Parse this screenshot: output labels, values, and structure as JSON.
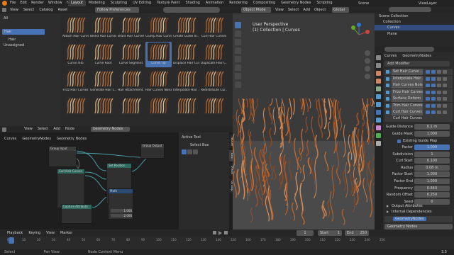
{
  "topbar": {
    "menus": [
      "File",
      "Edit",
      "Render",
      "Window",
      "Help"
    ],
    "workspaces": [
      "Layout",
      "Modeling",
      "Sculpting",
      "UV Editing",
      "Texture Paint",
      "Shading",
      "Animation",
      "Rendering",
      "Compositing",
      "Geometry Nodes",
      "Scripting"
    ],
    "active_workspace": "Layout",
    "scene": "Scene",
    "view_layer": "ViewLayer"
  },
  "asset_browser": {
    "header_menus": [
      "View",
      "Select",
      "Catalog",
      "Asset"
    ],
    "library": "Follow Preferences",
    "catalogs": [
      "All",
      "Hair",
      "Unassigned"
    ],
    "assets": [
      "Attach Hair Curve...",
      "Blend Hair Curves",
      "Braid Hair Curves",
      "Clump Hair Curves",
      "Create Guide In...",
      "Curl Hair Curves",
      "Curve Info",
      "Curve Root",
      "Curve Segment",
      "Curve Tip",
      "Displace Hair Cur...",
      "Duplicate Hair C...",
      "Frizz Hair Curves",
      "Generate Hair C...",
      "Hair Attachment...",
      "Hair Curves Noise",
      "Interpolate Hair ...",
      "Redistribute Cur...",
      "",
      "",
      "",
      "",
      "",
      ""
    ],
    "selected_asset": "Curve Tip"
  },
  "node_editor": {
    "menus": [
      "View",
      "Select",
      "Add",
      "Node"
    ],
    "node_tree": "Geometry Nodes",
    "breadcrumb": [
      "Curves",
      "GeometryNodes",
      "Geometry Nodes"
    ],
    "side_tabs": [
      "Node",
      "Tool",
      "View",
      "Group"
    ],
    "active_tool_title": "Active Tool",
    "active_tool_name": "Select Box",
    "nodes": {
      "group_input": "Group Input",
      "curl": "Curl Hair Curves",
      "group_output": "Group Output",
      "set_position": "Set Position",
      "capture": "Capture Attribute",
      "math": "Math",
      "value_a": "1.000",
      "value_b": "2.000"
    }
  },
  "viewport": {
    "mode": "Object Mode",
    "menus": [
      "View",
      "Select",
      "Add",
      "Object"
    ],
    "orientation": "Global",
    "perspective": "User Perspective",
    "collection": "(1) Collection | Curves"
  },
  "timeline": {
    "menus": [
      "Playback",
      "Keying",
      "View",
      "Marker"
    ],
    "current_frame": "1",
    "start_label": "Start",
    "start": "1",
    "end_label": "End",
    "end": "250",
    "ticks": [
      "0",
      "10",
      "20",
      "30",
      "40",
      "50",
      "60",
      "70",
      "80",
      "90",
      "100",
      "110",
      "120",
      "130",
      "140",
      "150",
      "160",
      "170",
      "180",
      "190",
      "200",
      "210",
      "220",
      "230",
      "240",
      "250"
    ]
  },
  "statusbar": {
    "items": [
      "Select",
      "Pan View",
      "Node Context Menu"
    ],
    "version": "3.5"
  },
  "outliner": {
    "items": [
      "Scene Collection",
      "Collection",
      "Curves",
      "Plane"
    ]
  },
  "properties": {
    "breadcrumb": [
      "Curves",
      "GeometryNodes"
    ],
    "add_modifier": "Add Modifier",
    "modifier_stack": [
      "Set Hair Curve ...",
      "Interpolate Hair...",
      "Hair Curves Noise",
      "Frizz Hair Curves",
      "Surface Deform",
      "Trim Hair Curves",
      "Curl Hair Curves"
    ],
    "curl_panel": {
      "title": "Curl Hair Curves",
      "fields": [
        {
          "label": "Guide Distance",
          "value": "0.1 m"
        },
        {
          "label": "Guide Mask",
          "value": "1.000"
        }
      ],
      "checkbox_label": "Existing Guide Map",
      "params": [
        {
          "label": "Factor",
          "value": "1.000",
          "accent": true
        },
        {
          "label": "Subdivision",
          "value": "1"
        },
        {
          "label": "Curl Start",
          "value": "0.100"
        },
        {
          "label": "Radius",
          "value": "0.08 m"
        },
        {
          "label": "Factor Start",
          "value": "1.000"
        },
        {
          "label": "Factor End",
          "value": "1.000"
        },
        {
          "label": "Frequency",
          "value": "0.840"
        },
        {
          "label": "Random Offset",
          "value": "0.250"
        },
        {
          "label": "Seed",
          "value": "0"
        }
      ],
      "sections": [
        "Output Attributes",
        "Internal Dependencies"
      ]
    },
    "gn_panel": {
      "title": "GeometryNodes",
      "node_group": "Geometry Nodes",
      "sections": [
        "Output Attributes",
        "Internal Dependencies"
      ]
    }
  },
  "colors": {
    "accent": "#4772b3",
    "hair": "#b8642f",
    "node_green": "#2e6b5e",
    "node_red": "#7a2f2f"
  }
}
